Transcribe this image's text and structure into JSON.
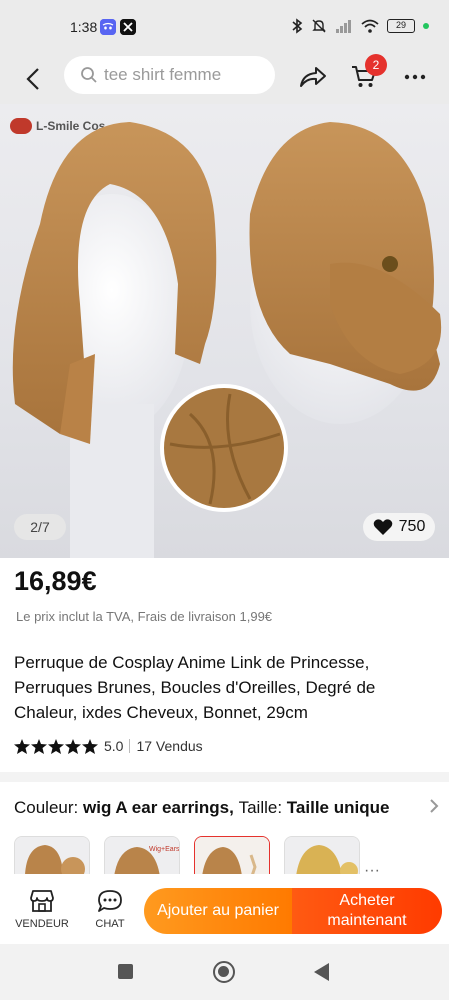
{
  "status_bar": {
    "time": "1:38",
    "apps": [
      "discord-icon",
      "x-icon"
    ],
    "battery": "29"
  },
  "header": {
    "search_placeholder": "tee shirt femme",
    "cart_count": "2"
  },
  "gallery": {
    "brand": "L-Smile Cos",
    "counter": "2/7",
    "likes": "750"
  },
  "product": {
    "price": "16,89€",
    "tax_note": "Le prix inclut la TVA, Frais de livraison 1,99€",
    "title": "Perruque de Cosplay Anime Link de Princesse, Perruques Brunes, Boucles d'Oreilles, Degré de Chaleur, ixdes Cheveux, Bonnet, 29cm",
    "rating": "5.0",
    "stars": 5,
    "sold": "17 Vendus"
  },
  "variant": {
    "color_label": "Couleur:",
    "color_value": "wig A ear earrings,",
    "size_label": "Taille:",
    "size_value": "Taille unique"
  },
  "thumbnails": [
    {
      "name": "variant-thumb-1"
    },
    {
      "name": "variant-thumb-2"
    },
    {
      "name": "variant-thumb-3"
    },
    {
      "name": "variant-thumb-4"
    }
  ],
  "bottom_bar": {
    "seller_label": "VENDEUR",
    "chat_label": "CHAT",
    "add_to_cart": "Ajouter au panier",
    "buy_now": "Acheter maintenant"
  },
  "colors": {
    "accent_orange": "#ff7a00",
    "accent_red": "#ff3b00",
    "badge_red": "#e5322d",
    "wig_brown": "#b9844a"
  }
}
